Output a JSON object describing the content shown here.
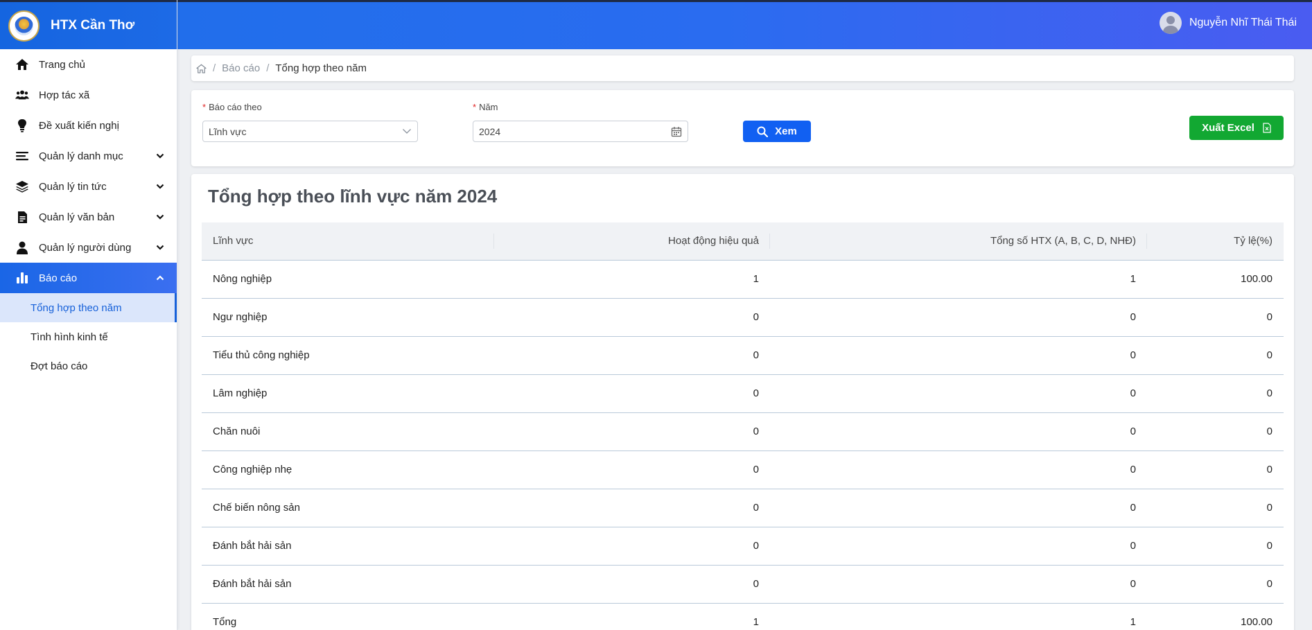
{
  "brand": {
    "name": "HTX Cần Thơ"
  },
  "user": {
    "name": "Nguyễn Nhĩ Thái Thái"
  },
  "sidebar": {
    "items": [
      {
        "label": "Trang chủ",
        "icon": "home-icon"
      },
      {
        "label": "Hợp tác xã",
        "icon": "users-icon"
      },
      {
        "label": "Đề xuất kiến nghị",
        "icon": "lightbulb-icon"
      },
      {
        "label": "Quản lý danh mục",
        "icon": "list-icon"
      },
      {
        "label": "Quản lý tin tức",
        "icon": "layers-icon"
      },
      {
        "label": "Quản lý văn bản",
        "icon": "document-icon"
      },
      {
        "label": "Quản lý người dùng",
        "icon": "user-icon"
      },
      {
        "label": "Báo cáo",
        "icon": "bar-chart-icon"
      }
    ],
    "subitems": [
      {
        "label": "Tổng hợp theo năm"
      },
      {
        "label": "Tình hình kinh tế"
      },
      {
        "label": "Đợt báo cáo"
      }
    ]
  },
  "breadcrumb": {
    "parent": "Báo cáo",
    "current": "Tổng hợp theo năm",
    "separator": "/"
  },
  "filters": {
    "report_by_label": "Báo cáo theo",
    "report_by_value": "Lĩnh vực",
    "year_label": "Năm",
    "year_value": "2024",
    "required_mark": "*",
    "view_button": "Xem",
    "export_button": "Xuất Excel"
  },
  "report": {
    "title": "Tổng hợp theo lĩnh vực năm 2024",
    "columns": [
      "Lĩnh vực",
      "Hoạt động hiệu quả",
      "Tổng số HTX (A, B, C, D, NHĐ)",
      "Tỷ lệ(%)"
    ],
    "rows": [
      [
        "Nông nghiệp",
        "1",
        "1",
        "100.00"
      ],
      [
        "Ngư nghiệp",
        "0",
        "0",
        "0"
      ],
      [
        "Tiểu thủ công nghiệp",
        "0",
        "0",
        "0"
      ],
      [
        "Lâm nghiệp",
        "0",
        "0",
        "0"
      ],
      [
        "Chăn nuôi",
        "0",
        "0",
        "0"
      ],
      [
        "Công nghiệp nhẹ",
        "0",
        "0",
        "0"
      ],
      [
        "Chế biến nông sản",
        "0",
        "0",
        "0"
      ],
      [
        "Đánh bắt hải sản",
        "0",
        "0",
        "0"
      ],
      [
        "Đánh bắt hải sản",
        "0",
        "0",
        "0"
      ],
      [
        "Tổng",
        "1",
        "1",
        "100.00"
      ]
    ]
  },
  "colors": {
    "primary": "#1160f2",
    "excel": "#12a832",
    "header": "#2a6cf0"
  }
}
